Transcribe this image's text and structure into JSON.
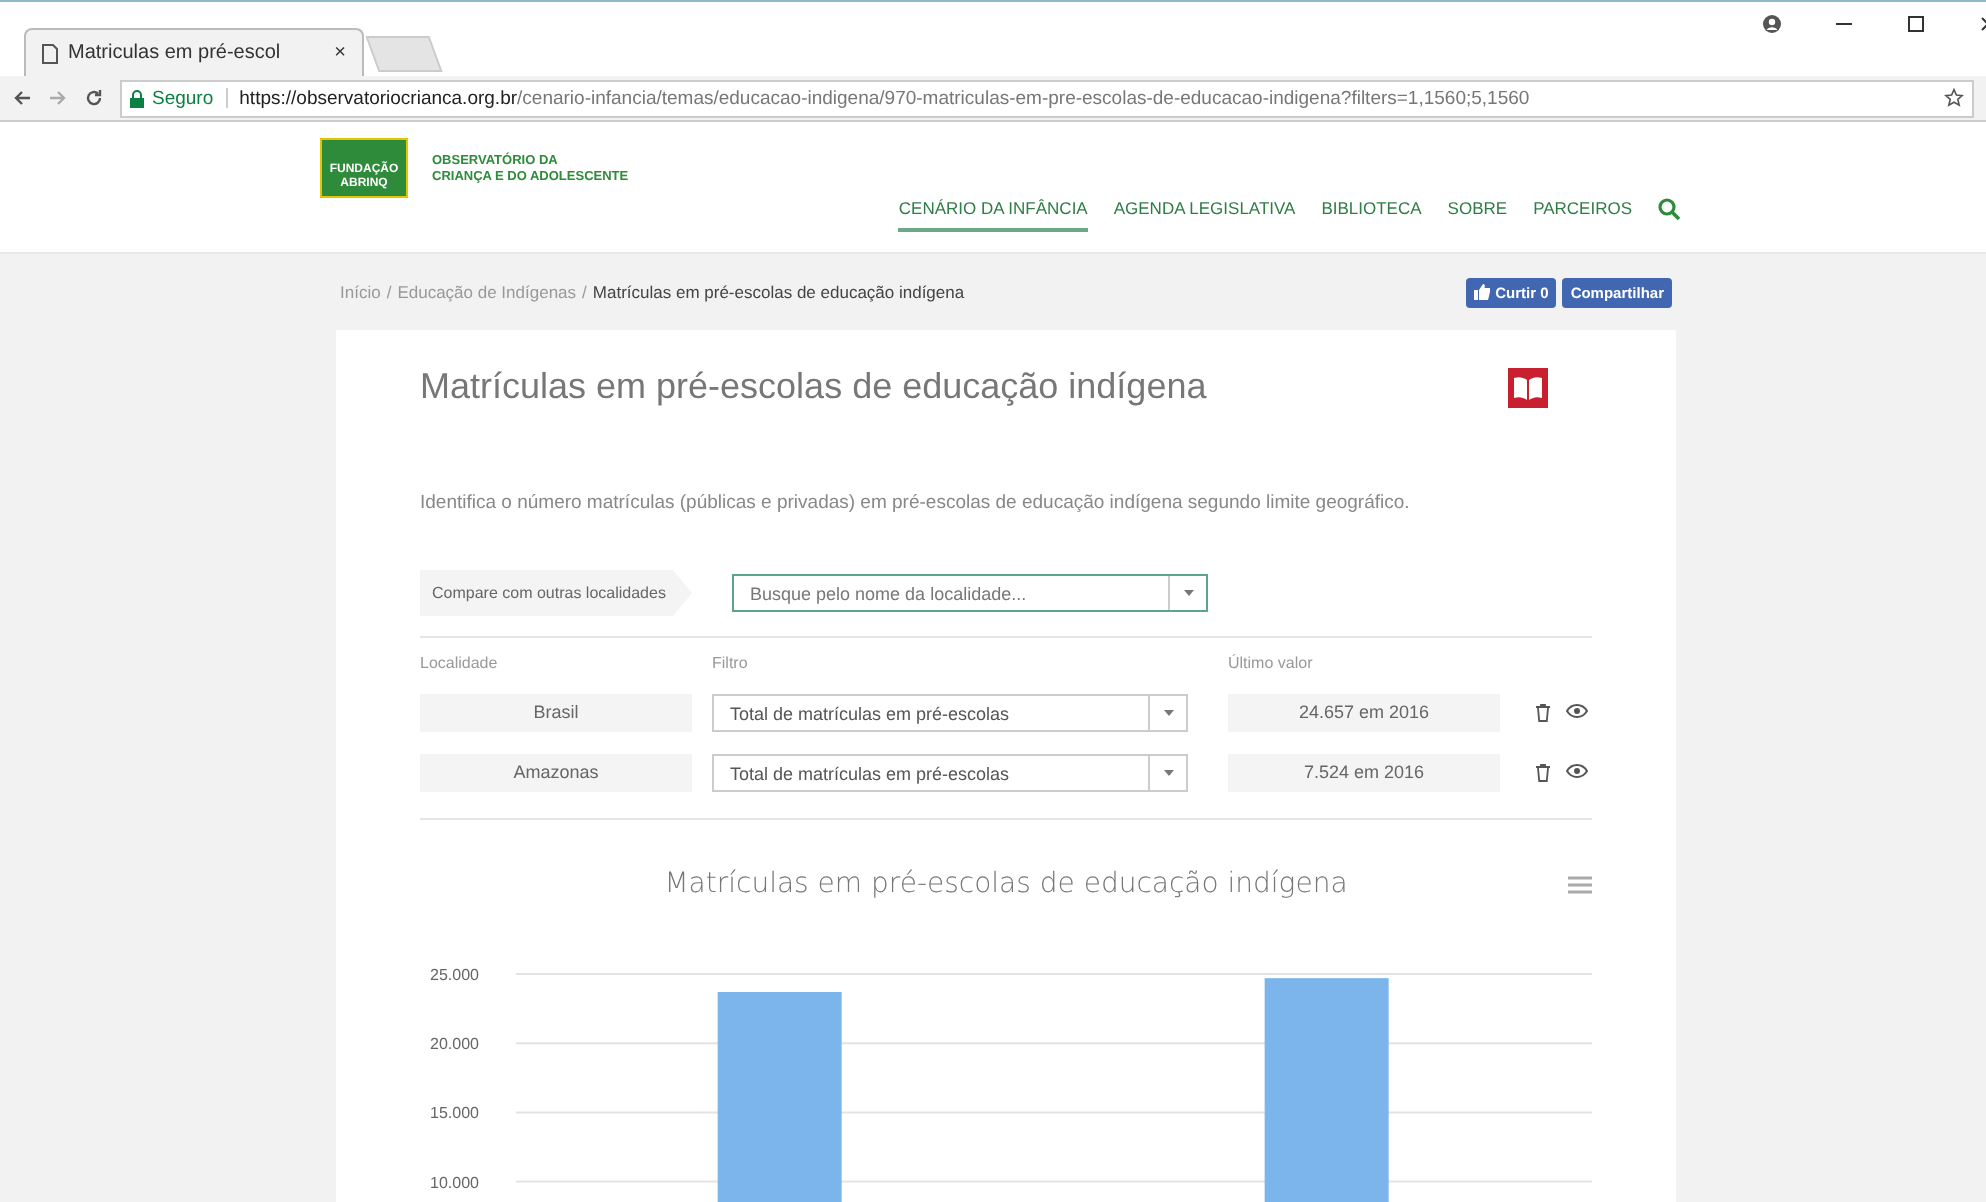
{
  "browser": {
    "tab_title": "Matriculas em pré-escol",
    "tab_close": "×",
    "secure_label": "Seguro",
    "url_host": "https://observatoriocrianca.org.br",
    "url_path": "/cenario-infancia/temas/educacao-indigena/970-matriculas-em-pre-escolas-de-educacao-indigena?filters=1,1560;5,1560"
  },
  "header": {
    "logo_text": "FUNDAÇÃO ABRINQ",
    "site_name_lines": [
      "OBSERVATÓRIO DA",
      "CRIANÇA E DO ADOLESCENTE"
    ],
    "nav": [
      {
        "label": "CENÁRIO DA INFÂNCIA",
        "selected": true
      },
      {
        "label": "AGENDA LEGISLATIVA",
        "selected": false
      },
      {
        "label": "BIBLIOTECA",
        "selected": false
      },
      {
        "label": "SOBRE",
        "selected": false
      },
      {
        "label": "PARCEIROS",
        "selected": false
      }
    ]
  },
  "breadcrumb": {
    "separator": "/",
    "items": [
      "Início",
      "Educação de Indígenas",
      "Matrículas em pré-escolas de educação indígena"
    ]
  },
  "social": {
    "like": "Curtir 0",
    "share": "Compartilhar"
  },
  "card": {
    "title": "Matrículas em pré-escolas de educação indígena",
    "description": "Identifica o número matrículas (públicas e privadas) em pré-escolas de educação indígena segundo limite geográfico.",
    "compare_label": "Compare com outras localidades",
    "search": {
      "placeholder": "Busque pelo nome da localidade..."
    },
    "table": {
      "columns": [
        "Localidade",
        "Filtro",
        "Último valor"
      ],
      "rows": [
        {
          "place": "Brasil",
          "filter": "Total de matrículas em pré-escolas",
          "value": "24.657 em 2016"
        },
        {
          "place": "Amazonas",
          "filter": "Total de matrículas em pré-escolas",
          "value": "7.524 em 2016"
        }
      ]
    },
    "chart": {
      "chart_data": {
        "type": "bar",
        "title": "Matrículas em pré-escolas de educação indígena",
        "values": [
          23700,
          24700
        ],
        "ylim": [
          0,
          25000
        ],
        "grid": true,
        "yticks": [
          {
            "value": 10000,
            "label": "10.000"
          },
          {
            "value": 15000,
            "label": "15.000"
          },
          {
            "value": 20000,
            "label": "20.000"
          },
          {
            "value": 25000,
            "label": "25.000"
          }
        ]
      }
    }
  }
}
